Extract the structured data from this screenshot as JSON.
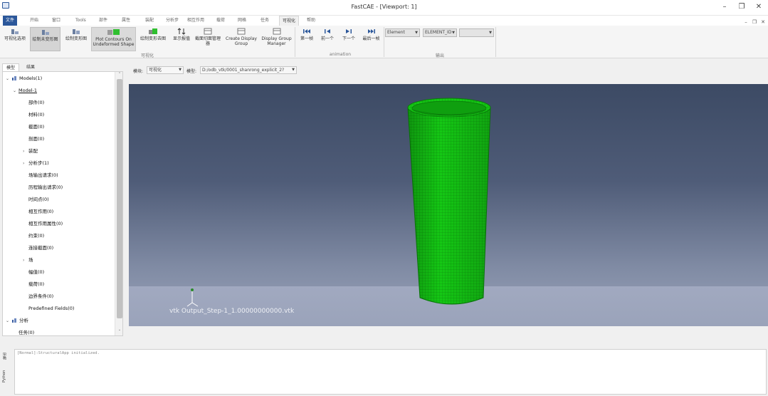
{
  "window": {
    "title": "FastCAE - [Viewport: 1]",
    "controls": {
      "minimize": "–",
      "maximize": "❐",
      "close": "✕"
    },
    "sub_controls": {
      "minimize": "–",
      "restore": "❐",
      "close": "✕"
    }
  },
  "ribbon": {
    "tabs": [
      "文件",
      "开始",
      "窗口",
      "Tools",
      "部件",
      "属性",
      "装配",
      "分析步",
      "相互作用",
      "载荷",
      "网格",
      "任务",
      "可视化",
      "帮助"
    ],
    "active_tab": "可视化",
    "visualization_group": {
      "label": "可视化",
      "buttons": [
        {
          "label": "可视化选项",
          "icon": "viz-options-icon"
        },
        {
          "label": "绘制未变形图",
          "icon": "undeformed-icon"
        },
        {
          "label": "绘制变形图",
          "icon": "deformed-icon"
        },
        {
          "label": "Plot Contours On Undeformed Shape",
          "icon": "contour-undeformed-icon"
        },
        {
          "label": "绘制变形去图",
          "icon": "contour-deformed-icon"
        },
        {
          "label": "显示报值",
          "icon": "arrows-icon"
        },
        {
          "label": "截面切面管理器",
          "icon": "cut-manager-icon"
        },
        {
          "label": "Create Display Group",
          "icon": "display-group-icon"
        },
        {
          "label": "Display Group Manager",
          "icon": "display-group-manager-icon"
        }
      ]
    },
    "animation_group": {
      "label": "animation",
      "buttons": [
        {
          "label": "第一帧",
          "icon": "first-frame-icon"
        },
        {
          "label": "前一个",
          "icon": "prev-frame-icon"
        },
        {
          "label": "下一个",
          "icon": "next-frame-icon"
        },
        {
          "label": "最后一帧",
          "icon": "last-frame-icon"
        }
      ]
    },
    "output_group": {
      "label": "输出",
      "combos": [
        "Element",
        "ELEMENT_ID",
        ""
      ]
    }
  },
  "tree": {
    "tabs": [
      "模型",
      "结果"
    ],
    "active_tab": "模型",
    "nodes": [
      {
        "label": "Models(1)",
        "toggle": "⌄",
        "icon": true,
        "level": 0
      },
      {
        "label": "Model-1",
        "toggle": "⌄",
        "icon": false,
        "level": 1
      },
      {
        "label": "部件(0)",
        "toggle": "",
        "icon": false,
        "level": 2
      },
      {
        "label": "材料(0)",
        "toggle": "",
        "icon": false,
        "level": 2
      },
      {
        "label": "截面(0)",
        "toggle": "",
        "icon": false,
        "level": 2
      },
      {
        "label": "剖面(0)",
        "toggle": "",
        "icon": false,
        "level": 2
      },
      {
        "label": "装配",
        "toggle": "›",
        "icon": false,
        "level": 2
      },
      {
        "label": "分析步(1)",
        "toggle": "›",
        "icon": false,
        "level": 2
      },
      {
        "label": "场输出请求(0)",
        "toggle": "",
        "icon": false,
        "level": 2
      },
      {
        "label": "历程输出请求(0)",
        "toggle": "",
        "icon": false,
        "level": 2
      },
      {
        "label": "时间点(0)",
        "toggle": "",
        "icon": false,
        "level": 2
      },
      {
        "label": "相互作用(0)",
        "toggle": "",
        "icon": false,
        "level": 2
      },
      {
        "label": "相互作用属性(0)",
        "toggle": "",
        "icon": false,
        "level": 2
      },
      {
        "label": "约束(0)",
        "toggle": "",
        "icon": false,
        "level": 2
      },
      {
        "label": "连接截面(0)",
        "toggle": "",
        "icon": false,
        "level": 2
      },
      {
        "label": "场",
        "toggle": "›",
        "icon": false,
        "level": 2
      },
      {
        "label": "幅值(0)",
        "toggle": "",
        "icon": false,
        "level": 2
      },
      {
        "label": "载荷(0)",
        "toggle": "",
        "icon": false,
        "level": 2
      },
      {
        "label": "边界条件(0)",
        "toggle": "",
        "icon": false,
        "level": 2
      },
      {
        "label": "Predefined Fields(0)",
        "toggle": "",
        "icon": false,
        "level": 2
      },
      {
        "label": "分析",
        "toggle": "⌄",
        "icon": true,
        "level": 0
      },
      {
        "label": "任务(0)",
        "toggle": "",
        "icon": false,
        "level": 1
      }
    ],
    "scroll_up": "⌃",
    "scroll_down": "⌄"
  },
  "selectors": {
    "module_label": "模块:",
    "module_value": "可视化",
    "model_label": "模型:",
    "model_value": "D:/odb_vtk/0001_shanrong_explicit_2?"
  },
  "viewport": {
    "caption": "vtk Output_Step-1_1.00000000000.vtk",
    "colors": {
      "mesh": "#14c814",
      "mesh_line": "#0a7a0a",
      "background_top": "#3c4a64",
      "background_bottom": "#9aa3ba"
    }
  },
  "output": {
    "side_tabs": [
      "输出",
      "Python"
    ],
    "text": "[Normal]:StructuralApp initialized."
  }
}
